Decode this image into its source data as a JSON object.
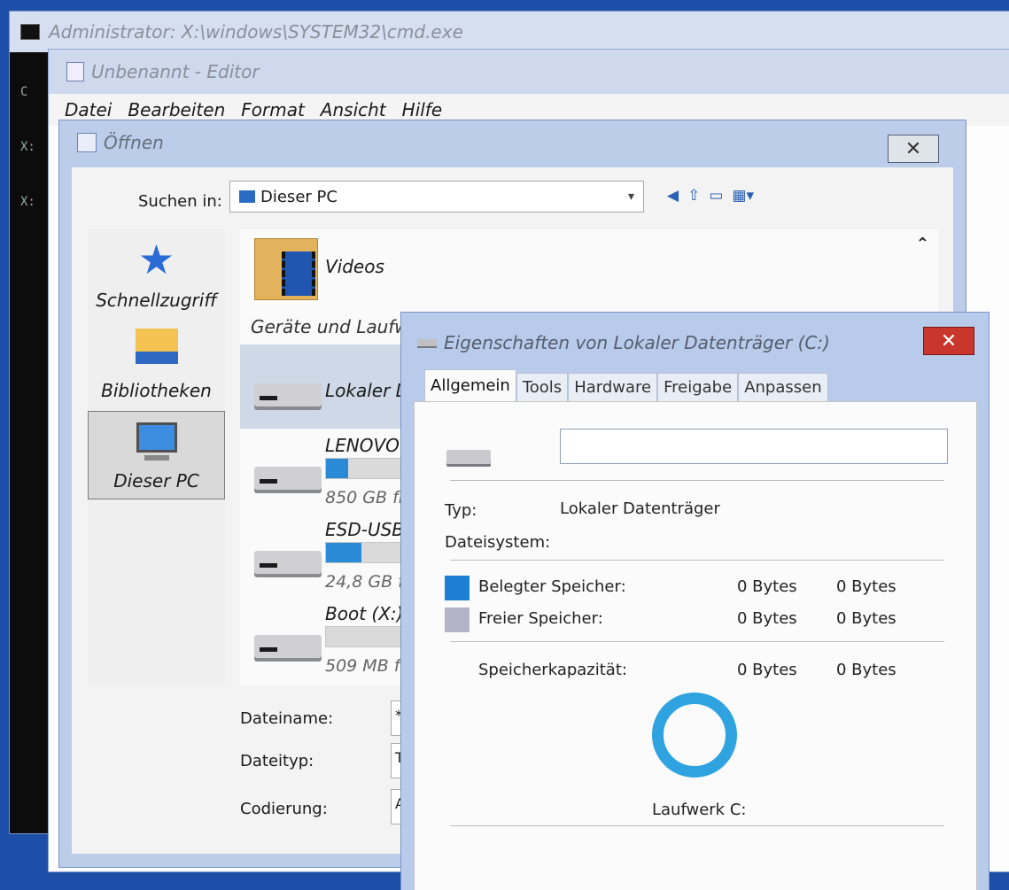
{
  "cmd": {
    "title": "Administrator: X:\\windows\\SYSTEM32\\cmd.exe",
    "lines": [
      "C",
      "X:",
      "X:"
    ]
  },
  "editor": {
    "title": "Unbenannt - Editor",
    "menu": [
      "Datei",
      "Bearbeiten",
      "Format",
      "Ansicht",
      "Hilfe"
    ]
  },
  "open_dialog": {
    "title": "Öffnen",
    "look_in_label": "Suchen in:",
    "look_in_value": "Dieser PC",
    "places": [
      "Schnellzugriff",
      "Bibliotheken",
      "Dieser PC"
    ],
    "videos_label": "Videos",
    "group_header": "Geräte und Laufwe",
    "drives": [
      {
        "name": "Lokaler D",
        "free": "",
        "usage": 0
      },
      {
        "name": "LENOVO",
        "free": "850 GB fr",
        "usage": 0.28
      },
      {
        "name": "ESD-USB",
        "free": "24,8 GB f",
        "usage": 0.45
      },
      {
        "name": "Boot (X:)",
        "free": "509 MB fr",
        "usage": 0
      }
    ],
    "fields": [
      {
        "label": "Dateiname:",
        "value": "*."
      },
      {
        "label": "Dateityp:",
        "value": "T"
      },
      {
        "label": "Codierung:",
        "value": "A"
      }
    ]
  },
  "properties": {
    "title": "Eigenschaften von Lokaler Datenträger (C:)",
    "tabs": [
      "Allgemein",
      "Tools",
      "Hardware",
      "Freigabe",
      "Anpassen"
    ],
    "name_value": "",
    "type_label": "Typ:",
    "type_value": "Lokaler Datenträger",
    "fs_label": "Dateisystem:",
    "used_label": "Belegter Speicher:",
    "used_bytes": "0 Bytes",
    "used_size": "0 Bytes",
    "free_label": "Freier Speicher:",
    "free_bytes": "0 Bytes",
    "free_size": "0 Bytes",
    "cap_label": "Speicherkapazität:",
    "cap_bytes": "0 Bytes",
    "cap_size": "0 Bytes",
    "drive_label": "Laufwerk C:",
    "colors": {
      "used": "#1e7fd2",
      "free": "#b4b4c8"
    }
  }
}
